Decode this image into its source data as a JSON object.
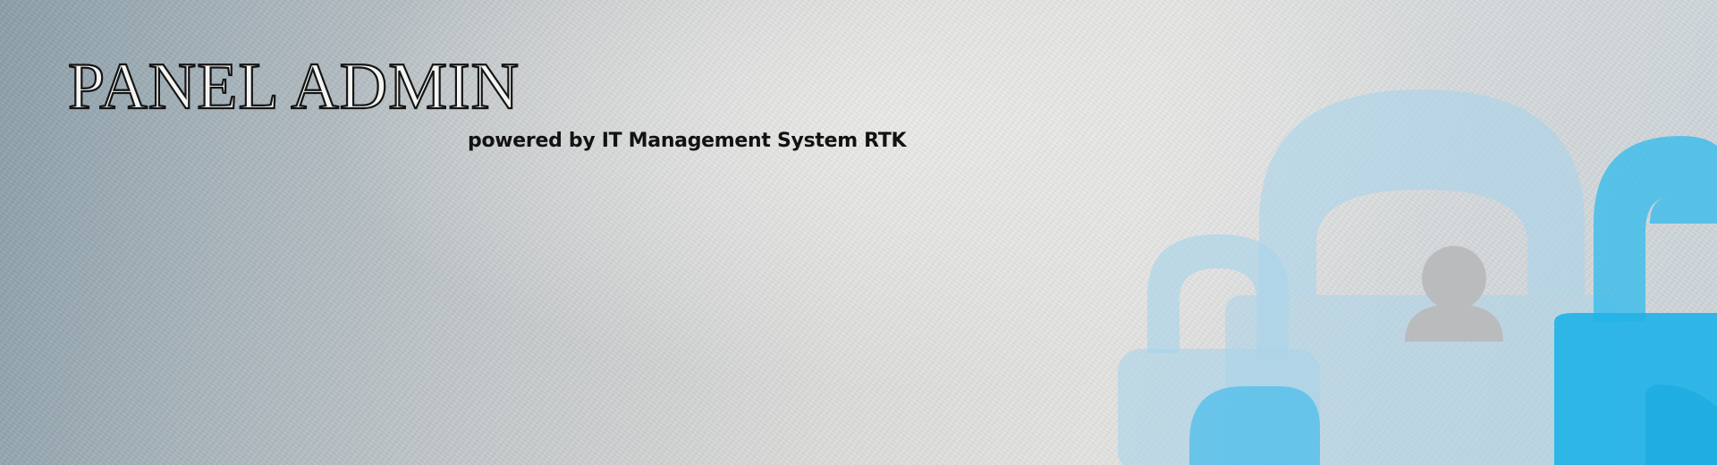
{
  "header": {
    "title": "PANEL ADMIN",
    "subtitle": "powered by IT Management System RTK"
  },
  "decor": {
    "icons": [
      "padlock-icon-small",
      "padlock-icon-large",
      "padlock-icon-right",
      "user-icon"
    ],
    "colors": {
      "lock_light": "#a9d4ea",
      "lock_mid": "#6cc4ec",
      "lock_bright": "#23b4e8",
      "user_silhouette": "#b9bbbd"
    }
  }
}
